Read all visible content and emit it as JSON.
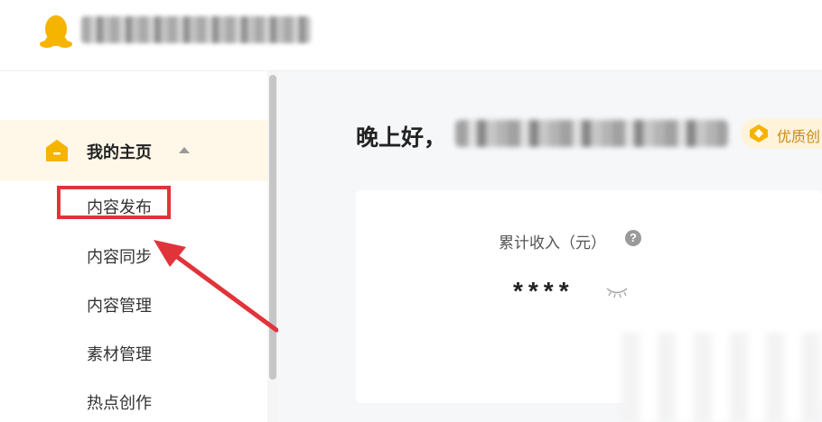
{
  "header": {
    "logo_icon": "penguin-icon",
    "platform_name": "腾讯内容开放平台"
  },
  "sidebar": {
    "home": {
      "icon": "home-icon",
      "label": "我的主页"
    },
    "items": [
      {
        "label": "内容发布"
      },
      {
        "label": "内容同步"
      },
      {
        "label": "内容管理"
      },
      {
        "label": "素材管理"
      },
      {
        "label": "热点创作"
      }
    ]
  },
  "main": {
    "greeting": "晚上好，",
    "quality_badge": {
      "icon": "diamond-icon",
      "label": "优质创"
    },
    "income": {
      "label": "累计收入（元）",
      "help_icon": "?",
      "value": "****",
      "toggle_icon": "eye-closed-icon"
    }
  },
  "colors": {
    "accent": "#f5b400",
    "highlight_red": "#e0343a",
    "active_bg": "#fff8e8"
  }
}
